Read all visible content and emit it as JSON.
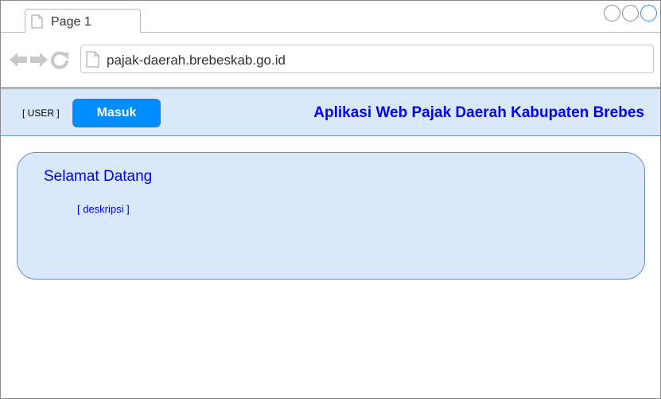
{
  "browser": {
    "tab": {
      "label": "Page 1"
    },
    "url": "pajak-daerah.brebeskab.go.id"
  },
  "header": {
    "user_label": "[ USER ]",
    "login_button": "Masuk",
    "title": "Aplikasi Web Pajak Daerah Kabupaten Brebes"
  },
  "content": {
    "welcome": "Selamat Datang",
    "description": "[ deskripsi ]"
  },
  "colors": {
    "header_bg": "#dae8fc",
    "header_border": "#6c8ebf",
    "accent": "#008cff",
    "title_text": "#0000ff"
  }
}
